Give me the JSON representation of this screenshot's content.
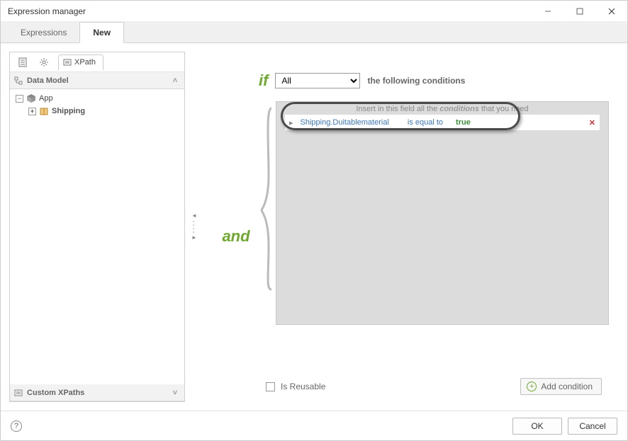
{
  "window": {
    "title": "Expression manager"
  },
  "tabs": {
    "expressions": "Expressions",
    "new": "New"
  },
  "left": {
    "xpath_tab": "XPath",
    "data_model_header": "Data Model",
    "custom_xpaths_header": "Custom XPaths",
    "tree": {
      "root": "App",
      "child": "Shipping"
    }
  },
  "expr": {
    "if_kw": "if",
    "quantifier": "All",
    "following": "the following conditions",
    "and_kw": "and",
    "hint_pre": "Insert in this field all the",
    "hint_em": "conditions",
    "hint_post": "that you need",
    "condition": {
      "lhs": "Shipping.Duitablematerial",
      "op": "is equal to",
      "val": "true"
    },
    "reusable_label": "Is Reusable",
    "add_label": "Add condition"
  },
  "buttons": {
    "ok": "OK",
    "cancel": "Cancel"
  }
}
